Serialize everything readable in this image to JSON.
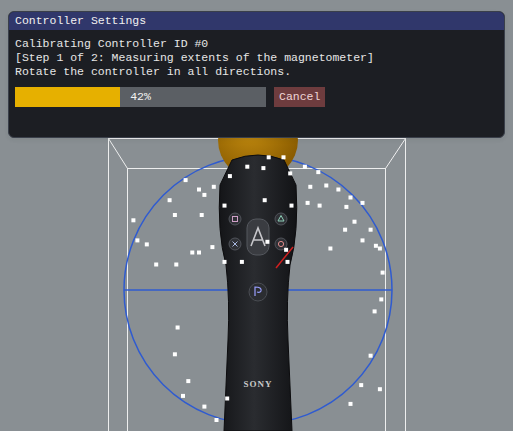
{
  "window": {
    "title": "Controller Settings"
  },
  "dialog": {
    "lines": [
      "Calibrating Controller ID #0",
      "[Step 1 of 2: Measuring extents of the magnetometer]",
      "Rotate the controller in all directions."
    ],
    "progress": {
      "level": 0.42,
      "reading": "42%"
    },
    "buttons": [
      "Cancel"
    ]
  },
  "scene": {
    "controller": {
      "logo": "SONY"
    },
    "samples": [
      [
        0.08,
        0.99
      ],
      [
        0.19,
        0.99
      ],
      [
        -0.08,
        0.92
      ],
      [
        0.04,
        0.91
      ],
      [
        0.35,
        0.92
      ],
      [
        0.45,
        0.88
      ],
      [
        -0.33,
        0.77
      ],
      [
        -0.54,
        0.82
      ],
      [
        -0.4,
        0.71
      ],
      [
        0.51,
        0.78
      ],
      [
        0.6,
        0.75
      ],
      [
        0.69,
        0.69
      ],
      [
        0.66,
        0.62
      ],
      [
        0.78,
        0.65
      ],
      [
        0.37,
        0.65
      ],
      [
        0.25,
        0.63
      ],
      [
        -0.62,
        0.56
      ],
      [
        -0.66,
        0.67
      ],
      [
        -0.42,
        0.56
      ],
      [
        0.39,
        0.77
      ],
      [
        0.72,
        0.51
      ],
      [
        0.84,
        0.45
      ],
      [
        0.88,
        0.33
      ],
      [
        0.91,
        0.31
      ],
      [
        -0.9,
        0.37
      ],
      [
        -0.83,
        0.34
      ],
      [
        -0.93,
        0.52
      ],
      [
        -0.76,
        0.19
      ],
      [
        -0.61,
        0.19
      ],
      [
        -0.49,
        0.28
      ],
      [
        -0.44,
        0.28
      ],
      [
        -0.25,
        0.21
      ],
      [
        -0.12,
        0.21
      ],
      [
        0.22,
        0.21
      ],
      [
        0.07,
        0.36
      ],
      [
        0.21,
        0.3
      ],
      [
        0.93,
        0.13
      ],
      [
        0.92,
        -0.07
      ],
      [
        0.87,
        -0.16
      ],
      [
        0.84,
        -0.49
      ],
      [
        -0.6,
        -0.28
      ],
      [
        -0.62,
        -0.48
      ],
      [
        -0.52,
        -0.68
      ],
      [
        -0.56,
        -0.79
      ],
      [
        -0.23,
        -0.81
      ],
      [
        -0.4,
        -0.87
      ],
      [
        -0.31,
        -0.97
      ],
      [
        0.69,
        -0.85
      ],
      [
        0.91,
        -0.74
      ],
      [
        0.77,
        -0.71
      ],
      [
        -0.34,
        0.32
      ],
      [
        0.54,
        0.31
      ],
      [
        -0.25,
        0.63
      ],
      [
        0.24,
        0.87
      ],
      [
        0.65,
        0.45
      ],
      [
        0.78,
        0.37
      ],
      [
        0.46,
        0.63
      ],
      [
        0.05,
        0.67
      ],
      [
        -0.21,
        0.85
      ],
      [
        -0.44,
        0.75
      ]
    ]
  }
}
